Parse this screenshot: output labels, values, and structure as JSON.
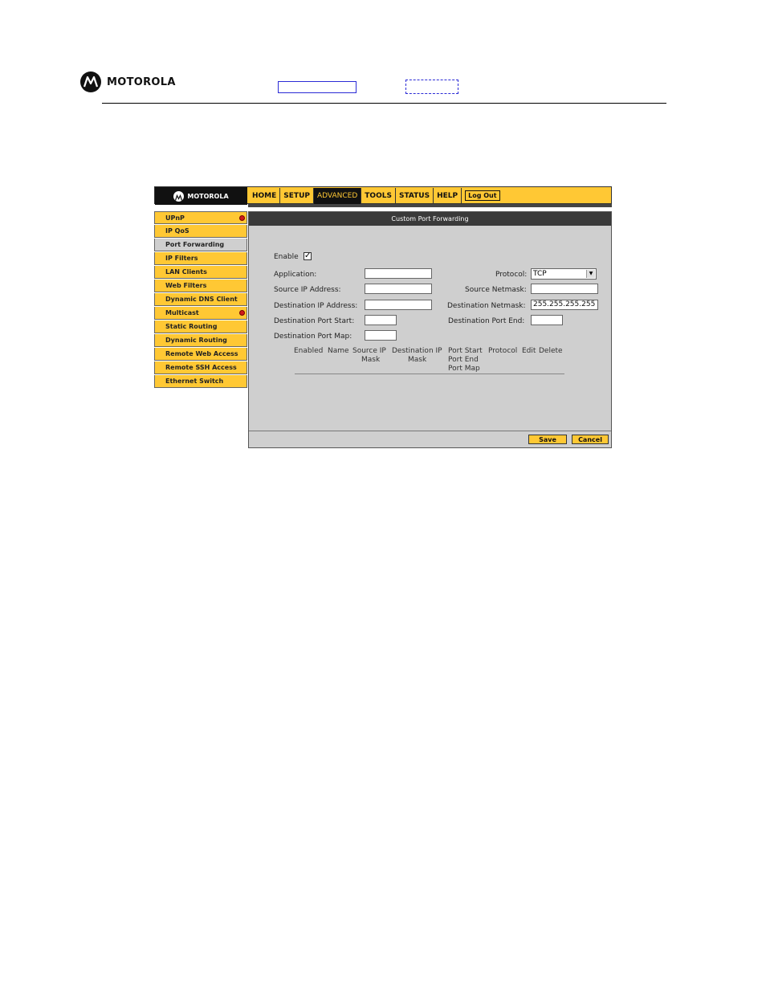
{
  "doc_header": {
    "logo_text": "MOTOROLA"
  },
  "app": {
    "logo_text": "MOTOROLA",
    "nav": [
      {
        "label": "HOME"
      },
      {
        "label": "SETUP"
      },
      {
        "label": "ADVANCED",
        "active": true
      },
      {
        "label": "TOOLS"
      },
      {
        "label": "STATUS"
      },
      {
        "label": "HELP"
      }
    ],
    "logout_label": "Log Out"
  },
  "sidebar": {
    "items": [
      {
        "label": "UPnP",
        "badge": true
      },
      {
        "label": "IP QoS"
      },
      {
        "label": "Port Forwarding",
        "active": true
      },
      {
        "label": "IP Filters"
      },
      {
        "label": "LAN Clients"
      },
      {
        "label": "Web Filters"
      },
      {
        "label": "Dynamic DNS Client"
      },
      {
        "label": "Multicast",
        "badge": true
      },
      {
        "label": "Static Routing"
      },
      {
        "label": "Dynamic Routing"
      },
      {
        "label": "Remote Web Access"
      },
      {
        "label": "Remote SSH Access"
      },
      {
        "label": "Ethernet Switch"
      }
    ]
  },
  "panel": {
    "title": "Custom Port Forwarding",
    "enable_label": "Enable",
    "enable_checked": true,
    "application_label": "Application:",
    "application_value": "",
    "protocol_label": "Protocol:",
    "protocol_value": "TCP",
    "source_ip_label": "Source IP Address:",
    "source_ip_value": "",
    "source_netmask_label": "Source Netmask:",
    "source_netmask_value": "",
    "dest_ip_label": "Destination IP Address:",
    "dest_ip_value": "",
    "dest_netmask_label": "Destination Netmask:",
    "dest_netmask_value": "255.255.255.255",
    "dest_port_start_label": "Destination Port Start:",
    "dest_port_start_value": "",
    "dest_port_end_label": "Destination Port End:",
    "dest_port_end_value": "",
    "dest_port_map_label": "Destination Port Map:",
    "dest_port_map_value": "",
    "table_headers": {
      "enabled": "Enabled",
      "name": "Name",
      "source_ip": "Source IP",
      "source_mask": "Mask",
      "dest_ip": "Destination IP",
      "dest_mask": "Mask",
      "port_start": "Port Start",
      "port_end": "Port End",
      "port_map": "Port Map",
      "protocol": "Protocol",
      "edit": "Edit",
      "delete": "Delete"
    },
    "save_label": "Save",
    "cancel_label": "Cancel"
  },
  "colors": {
    "accent": "#ffc834",
    "panel_bg": "#cfcfcf",
    "dark": "#111111"
  }
}
